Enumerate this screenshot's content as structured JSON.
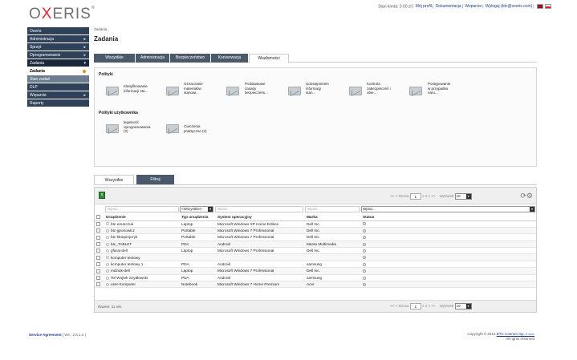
{
  "brand": {
    "logo_left": "O",
    "logo_mid": "X",
    "logo_right": "ERIS",
    "tm": "®"
  },
  "topbar": {
    "account": "Stan konta: 3.00 zł",
    "profile": "Mój profil",
    "docs": "Dokumentacja",
    "support": "Wsparcie",
    "logout": "Wyloguj (btc@oxeris.com)"
  },
  "sidebar": {
    "items": [
      {
        "label": "Oxeris",
        "arrow": ""
      },
      {
        "label": "Administracja",
        "arrow": "▸"
      },
      {
        "label": "Sprzęt",
        "arrow": "▸"
      },
      {
        "label": "Oprogramowanie",
        "arrow": "▸"
      },
      {
        "label": "Zadania",
        "arrow": "▾"
      }
    ],
    "sub": [
      {
        "label": "Zadania"
      },
      {
        "label": "Stan zadań"
      }
    ],
    "items2": [
      {
        "label": "DLP",
        "arrow": ""
      },
      {
        "label": "Wsparcie",
        "arrow": "▸"
      },
      {
        "label": "Raporty",
        "arrow": ""
      }
    ]
  },
  "main": {
    "breadcrumb": "Zadania",
    "title": "Zadania"
  },
  "tabs": [
    "Wszystkie",
    "Administracja",
    "Bezpieczeństwo",
    "Konserwacja",
    "Wiadomości"
  ],
  "polityki": {
    "header": "Polityki",
    "items": [
      {
        "l1": "Klasyfikowanie",
        "l2": "informacji sta..."
      },
      {
        "l1": "Oznaczanie",
        "l2": "materiałów",
        "l3": "stanowi..."
      },
      {
        "l1": "Podstawowe",
        "l2": "zasady",
        "l3": "bezpieczeńs..."
      },
      {
        "l1": "Udostępnienie",
        "l2": "informacji",
        "l3": "stan..."
      },
      {
        "l1": "Kontrola",
        "l2": "zabezpieczeń i",
        "l3": "obie..."
      },
      {
        "l1": "Postępowanie",
        "l2": "w przypadku",
        "l3": "naru..."
      }
    ]
  },
  "polityki_user": {
    "header": "Polityki użytkownika",
    "items": [
      {
        "l1": "legalność",
        "l2": "oprogramowania",
        "l3": "(2)"
      },
      {
        "l1": "Ćwiczenia",
        "l2": "praktyczne (2)"
      }
    ]
  },
  "lower_tabs": {
    "all": "Wszystkie",
    "filter": "Filtruj"
  },
  "grid": {
    "pager": {
      "prev": "<< < Strona",
      "page": "1",
      "of": "z 2 > >>",
      "show_label": "Wyświetl",
      "per_page": "10"
    },
    "filter": {
      "p1": "Wpisz...",
      "sel": "<Wszystkie>",
      "p2": "Wpisz...",
      "p3": "Wpisz...",
      "p4": "Wpisz..."
    },
    "headers": [
      "Urządzenie",
      "Typ urządzenia",
      "System operacyjny",
      "Marka",
      "Status"
    ],
    "rows": [
      [
        "btc-emarczuk",
        "Laptop",
        "Microsoft Windows XP Home Edition",
        "Dell Inc."
      ],
      [
        "btc-jgronowicz",
        "Portable",
        "Microsoft Windows 7 Professional",
        "Dell Inc."
      ],
      [
        "btc-kkarpiejczyk",
        "Portable",
        "Microsoft Windows 7 Professional",
        "Dell Inc."
      ],
      [
        "btc_TABLET",
        "PDA",
        "Android",
        "Manta Multimedia"
      ],
      [
        "gfarat-dell",
        "Laptop",
        "Microsoft Windows 7 Professional",
        "Dell Inc."
      ],
      [
        "kcmputer testowy",
        "",
        "",
        ""
      ],
      [
        "kcmputer testowy 1",
        "PDA",
        "Android",
        "samsung"
      ],
      [
        "mdziuk-dell",
        "Laptop",
        "Microsoft Windows 7 Professional",
        "Dell Inc."
      ],
      [
        "Tel Wojtek Szydłowski",
        "PDA",
        "Android",
        "samsung"
      ],
      [
        "user-Komputer",
        "Notebook",
        "Microsoft Windows 7 Home Premium",
        "Acer"
      ]
    ],
    "total": "Razem: 11 rek."
  },
  "footer": {
    "agreement": "Service Agreement",
    "version": "Ver.: 2.8.1.3",
    "copyright": "Copyright © 2014",
    "company": "BTC Connect Sp. z o.o.",
    "rights": "All rights reserved"
  },
  "colors": {
    "sidebar_bg": "#2e4158",
    "accent": "#e2272b",
    "tab_bg": "#4b5a6a"
  }
}
